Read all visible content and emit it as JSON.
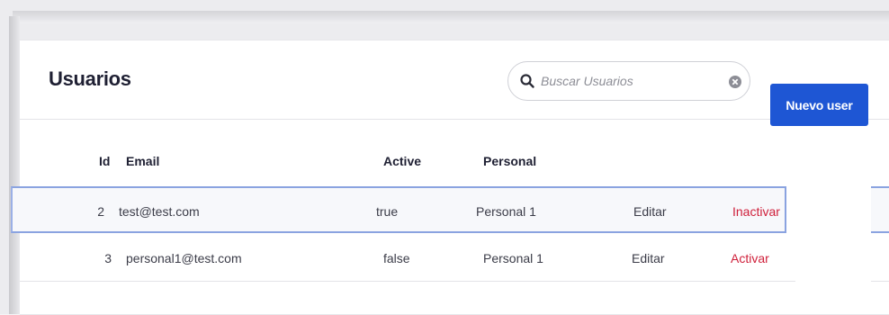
{
  "page": {
    "title": "Usuarios"
  },
  "search": {
    "placeholder": "Buscar Usuarios",
    "value": "",
    "icon": "search-icon",
    "clear_icon": "clear-icon"
  },
  "actions": {
    "new_label": "Nuevo user"
  },
  "table": {
    "columns": [
      "Id",
      "Email",
      "Active",
      "Personal"
    ],
    "rows": [
      {
        "id": "2",
        "email": "test@test.com",
        "active": "true",
        "personal": "Personal 1",
        "edit": "Editar",
        "toggle": "Inactivar"
      },
      {
        "id": "3",
        "email": "personal1@test.com",
        "active": "false",
        "personal": "Personal 1",
        "edit": "Editar",
        "toggle": "Activar"
      }
    ]
  },
  "colors": {
    "accent": "#1e56d4",
    "danger": "#cf1f3a",
    "selected_border": "#8aa3e0"
  }
}
